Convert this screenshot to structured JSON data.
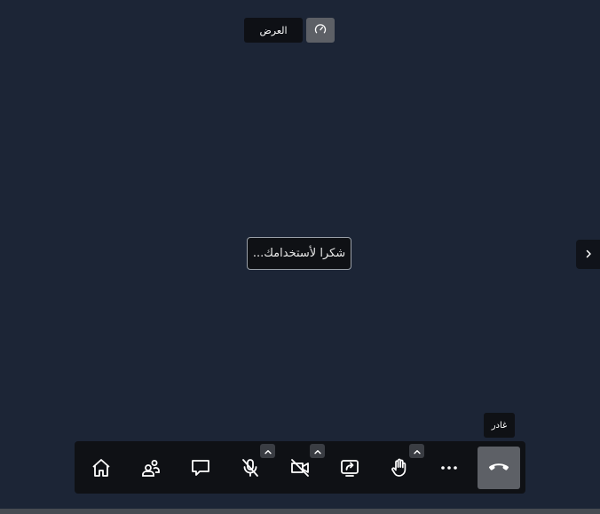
{
  "top_bar": {
    "view_label": "العرض",
    "speed_icon": "gauge-icon"
  },
  "message": {
    "text": "...شكرا لأستخدامك"
  },
  "side_panel": {
    "toggle_icon": "chevron-right-icon"
  },
  "tooltip": {
    "text": "غادر"
  },
  "toolbar": {
    "items": [
      {
        "icon": "home-icon"
      },
      {
        "icon": "participants-icon"
      },
      {
        "icon": "chat-icon"
      },
      {
        "icon": "microphone-muted-icon",
        "has_options": true
      },
      {
        "icon": "camera-off-icon",
        "has_options": true
      },
      {
        "icon": "share-screen-icon"
      },
      {
        "icon": "raise-hand-icon",
        "has_options": true
      },
      {
        "icon": "more-options-icon"
      },
      {
        "icon": "hang-up-icon"
      }
    ]
  },
  "colors": {
    "background": "#1c2536",
    "toolbar": "#0f1115",
    "active_button": "#5d6066"
  }
}
